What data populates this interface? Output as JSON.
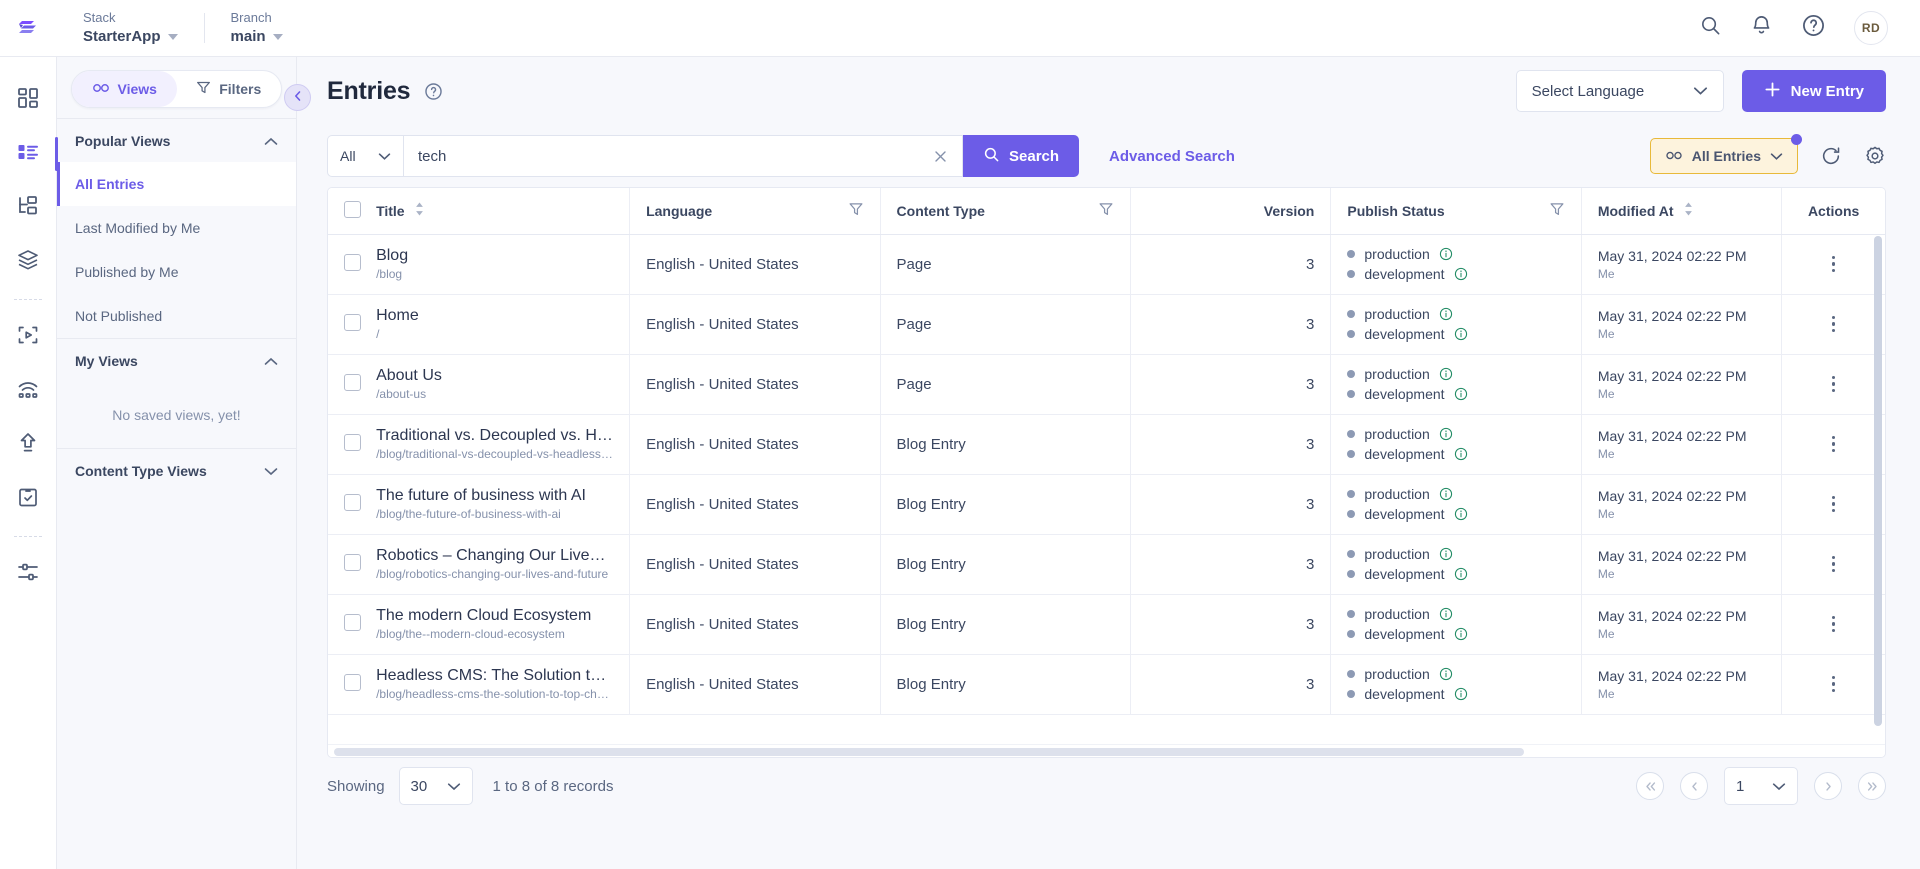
{
  "topbar": {
    "logo_icon": "contentstack-logo-icon",
    "stack": {
      "label": "Stack",
      "value": "StarterApp"
    },
    "branch": {
      "label": "Branch",
      "value": "main"
    },
    "actions": [
      {
        "name": "search-icon"
      },
      {
        "name": "notifications-bell-icon"
      },
      {
        "name": "help-circle-icon"
      }
    ],
    "avatar_initials": "RD"
  },
  "rail": {
    "items": [
      {
        "name": "dashboard-icon",
        "active": false
      },
      {
        "name": "content-entries-icon",
        "active": true
      },
      {
        "name": "content-models-icon",
        "active": false
      },
      {
        "name": "assets-stack-icon",
        "active": false
      },
      {
        "name": "live-preview-icon",
        "active": false
      },
      {
        "name": "releases-icon",
        "active": false
      },
      {
        "name": "publish-queue-icon",
        "active": false
      },
      {
        "name": "audit-log-icon",
        "active": false
      },
      {
        "name": "settings-sliders-icon",
        "active": false
      }
    ]
  },
  "views_panel": {
    "segments": [
      {
        "label": "Views",
        "icon": "views-infinity-icon",
        "active": true
      },
      {
        "label": "Filters",
        "icon": "filter-funnel-icon",
        "active": false
      }
    ],
    "sections": [
      {
        "title": "Popular Views",
        "expanded": true,
        "items": [
          {
            "label": "All Entries",
            "active": true
          },
          {
            "label": "Last Modified by Me",
            "active": false
          },
          {
            "label": "Published by Me",
            "active": false
          },
          {
            "label": "Not Published",
            "active": false
          }
        ]
      },
      {
        "title": "My Views",
        "expanded": true,
        "empty_text": "No saved views, yet!",
        "items": []
      },
      {
        "title": "Content Type Views",
        "expanded": false,
        "items": []
      }
    ]
  },
  "page": {
    "title": "Entries",
    "help_icon": "help-circle-icon",
    "collapse_icon": "chevron-left-icon",
    "language_select": {
      "value": "Select Language"
    },
    "new_entry_button": "New Entry"
  },
  "search": {
    "scope_value": "All",
    "query": "tech",
    "placeholder": "Search",
    "search_button": "Search",
    "advanced_link": "Advanced Search",
    "view_chip": "All Entries",
    "refresh_icon": "refresh-icon",
    "settings_icon": "gear-icon"
  },
  "table": {
    "columns": [
      {
        "key": "title",
        "label": "Title",
        "sortable": true,
        "filterable": false
      },
      {
        "key": "language",
        "label": "Language",
        "sortable": false,
        "filterable": true
      },
      {
        "key": "content_type",
        "label": "Content Type",
        "sortable": false,
        "filterable": true
      },
      {
        "key": "version",
        "label": "Version",
        "sortable": false,
        "filterable": false
      },
      {
        "key": "publish_status",
        "label": "Publish Status",
        "sortable": false,
        "filterable": true
      },
      {
        "key": "modified_at",
        "label": "Modified At",
        "sortable": true,
        "filterable": false
      },
      {
        "key": "actions",
        "label": "Actions",
        "sortable": false,
        "filterable": false
      }
    ],
    "rows": [
      {
        "title": "Blog",
        "url": "/blog",
        "language": "English - United States",
        "content_type": "Page",
        "version": "3",
        "statuses": [
          "production",
          "development"
        ],
        "modified_at": "May 31, 2024 02:22 PM",
        "modified_by": "Me"
      },
      {
        "title": "Home",
        "url": "/",
        "language": "English - United States",
        "content_type": "Page",
        "version": "3",
        "statuses": [
          "production",
          "development"
        ],
        "modified_at": "May 31, 2024 02:22 PM",
        "modified_by": "Me"
      },
      {
        "title": "About Us",
        "url": "/about-us",
        "language": "English - United States",
        "content_type": "Page",
        "version": "3",
        "statuses": [
          "production",
          "development"
        ],
        "modified_at": "May 31, 2024 02:22 PM",
        "modified_by": "Me"
      },
      {
        "title": "Traditional vs. Decoupled vs. Hea…",
        "url": "/blog/traditional-vs-decoupled-vs-headless-…",
        "language": "English - United States",
        "content_type": "Blog Entry",
        "version": "3",
        "statuses": [
          "production",
          "development"
        ],
        "modified_at": "May 31, 2024 02:22 PM",
        "modified_by": "Me"
      },
      {
        "title": "The future of business with AI",
        "url": "/blog/the-future-of-business-with-ai",
        "language": "English - United States",
        "content_type": "Blog Entry",
        "version": "3",
        "statuses": [
          "production",
          "development"
        ],
        "modified_at": "May 31, 2024 02:22 PM",
        "modified_by": "Me"
      },
      {
        "title": "Robotics – Changing Our Lives an…",
        "url": "/blog/robotics-changing-our-lives-and-future",
        "language": "English - United States",
        "content_type": "Blog Entry",
        "version": "3",
        "statuses": [
          "production",
          "development"
        ],
        "modified_at": "May 31, 2024 02:22 PM",
        "modified_by": "Me"
      },
      {
        "title": "The modern Cloud Ecosystem",
        "url": "/blog/the--modern-cloud-ecosystem",
        "language": "English - United States",
        "content_type": "Blog Entry",
        "version": "3",
        "statuses": [
          "production",
          "development"
        ],
        "modified_at": "May 31, 2024 02:22 PM",
        "modified_by": "Me"
      },
      {
        "title": "Headless CMS: The Solution to T…",
        "url": "/blog/headless-cms-the-solution-to-top-cha…",
        "language": "English - United States",
        "content_type": "Blog Entry",
        "version": "3",
        "statuses": [
          "production",
          "development"
        ],
        "modified_at": "May 31, 2024 02:22 PM",
        "modified_by": "Me"
      }
    ]
  },
  "footer": {
    "showing_label": "Showing",
    "page_size": "30",
    "records_text": "1 to 8 of 8 records",
    "current_page": "1"
  },
  "colors": {
    "accent": "#6c5ce7",
    "chip_bg": "#fdf3dd",
    "chip_border": "#e8b93a",
    "status_dot": "#8d9ab4",
    "info_icon": "#1f8a63",
    "page_bg": "#f7f8fc"
  }
}
